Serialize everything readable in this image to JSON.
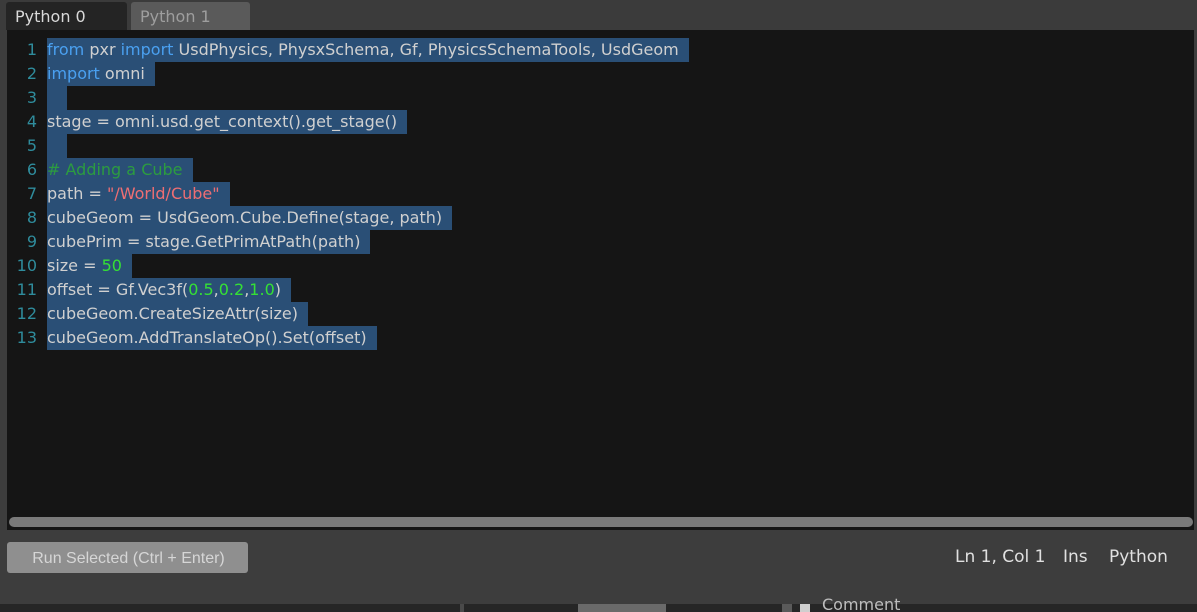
{
  "tabs": [
    {
      "label": "Python 0",
      "active": true
    },
    {
      "label": "Python 1",
      "active": false
    }
  ],
  "code_lines": [
    {
      "num": "1",
      "tokens": [
        [
          "kw",
          "from"
        ],
        [
          "t",
          " pxr "
        ],
        [
          "kw",
          "import"
        ],
        [
          "t",
          " UsdPhysics, PhysxSchema, Gf, PhysicsSchemaTools, UsdGeom"
        ]
      ]
    },
    {
      "num": "2",
      "tokens": [
        [
          "kw",
          "import"
        ],
        [
          "t",
          " omni"
        ]
      ]
    },
    {
      "num": "3",
      "tokens": []
    },
    {
      "num": "4",
      "tokens": [
        [
          "t",
          "stage = omni.usd.get_context().get_stage()"
        ]
      ]
    },
    {
      "num": "5",
      "tokens": []
    },
    {
      "num": "6",
      "tokens": [
        [
          "com",
          "# Adding a Cube"
        ]
      ]
    },
    {
      "num": "7",
      "tokens": [
        [
          "t",
          "path = "
        ],
        [
          "str",
          "\"/World/Cube\""
        ]
      ]
    },
    {
      "num": "8",
      "tokens": [
        [
          "t",
          "cubeGeom = UsdGeom.Cube.Define(stage, path)"
        ]
      ]
    },
    {
      "num": "9",
      "tokens": [
        [
          "t",
          "cubePrim = stage.GetPrimAtPath(path)"
        ]
      ]
    },
    {
      "num": "10",
      "tokens": [
        [
          "t",
          "size = "
        ],
        [
          "num",
          "50"
        ]
      ]
    },
    {
      "num": "11",
      "tokens": [
        [
          "t",
          "offset = Gf.Vec3f("
        ],
        [
          "num",
          "0.5"
        ],
        [
          "t",
          ","
        ],
        [
          "num",
          "0.2"
        ],
        [
          "t",
          ","
        ],
        [
          "num",
          "1.0"
        ],
        [
          "t",
          ")"
        ]
      ]
    },
    {
      "num": "12",
      "tokens": [
        [
          "t",
          "cubeGeom.CreateSizeAttr(size)"
        ]
      ]
    },
    {
      "num": "13",
      "tokens": [
        [
          "t",
          "cubeGeom.AddTranslateOp().Set(offset)"
        ]
      ]
    }
  ],
  "toolbar": {
    "run_label": "Run Selected (Ctrl + Enter)"
  },
  "status": {
    "position": "Ln 1, Col 1",
    "mode": "Ins",
    "language": "Python"
  },
  "below": {
    "partial_text": "Comment"
  },
  "colors": {
    "selection": "#2a4f76",
    "keyword": "#4aa0f0",
    "string": "#ee6e73",
    "number": "#35e035",
    "comment": "#2c9c40",
    "line_number": "#2f8c9c"
  }
}
